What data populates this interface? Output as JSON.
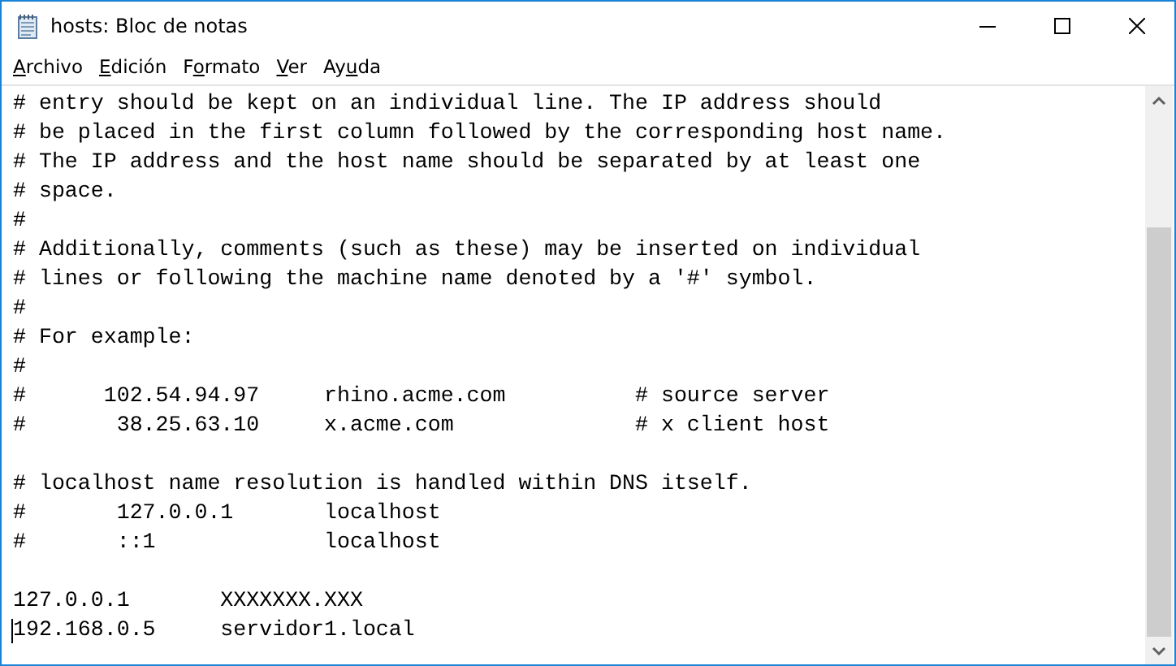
{
  "window": {
    "title": "hosts: Bloc de notas"
  },
  "menu": [
    {
      "access_key": "A",
      "rest": "rchivo"
    },
    {
      "access_key": "E",
      "rest": "dición"
    },
    {
      "lead": "F",
      "access_key": "o",
      "rest": "rmato"
    },
    {
      "access_key": "V",
      "rest": "er"
    },
    {
      "lead": "Ay",
      "access_key": "u",
      "rest": "da"
    }
  ],
  "editor": {
    "lines": [
      {
        "text": "# entry should be kept on an individual line. The IP address should",
        "cursor": false
      },
      {
        "text": "# be placed in the first column followed by the corresponding host name.",
        "cursor": false
      },
      {
        "text": "# The IP address and the host name should be separated by at least one",
        "cursor": false
      },
      {
        "text": "# space.",
        "cursor": false
      },
      {
        "text": "#",
        "cursor": false
      },
      {
        "text": "# Additionally, comments (such as these) may be inserted on individual",
        "cursor": false
      },
      {
        "text": "# lines or following the machine name denoted by a '#' symbol.",
        "cursor": false
      },
      {
        "text": "#",
        "cursor": false
      },
      {
        "text": "# For example:",
        "cursor": false
      },
      {
        "text": "#",
        "cursor": false
      },
      {
        "text": "#      102.54.94.97     rhino.acme.com          # source server",
        "cursor": false
      },
      {
        "text": "#       38.25.63.10     x.acme.com              # x client host",
        "cursor": false
      },
      {
        "cursor": false
      },
      {
        "text": "# localhost name resolution is handled within DNS itself.",
        "cursor": false
      },
      {
        "text": "#       127.0.0.1       localhost",
        "cursor": false
      },
      {
        "text": "#       ::1             localhost",
        "cursor": false
      },
      {
        "cursor": false
      },
      {
        "text": "127.0.0.1       XXXXXXX.XXX",
        "cursor": false
      },
      {
        "text": "192.168.0.5     servidor1.local",
        "cursor": true
      }
    ]
  }
}
